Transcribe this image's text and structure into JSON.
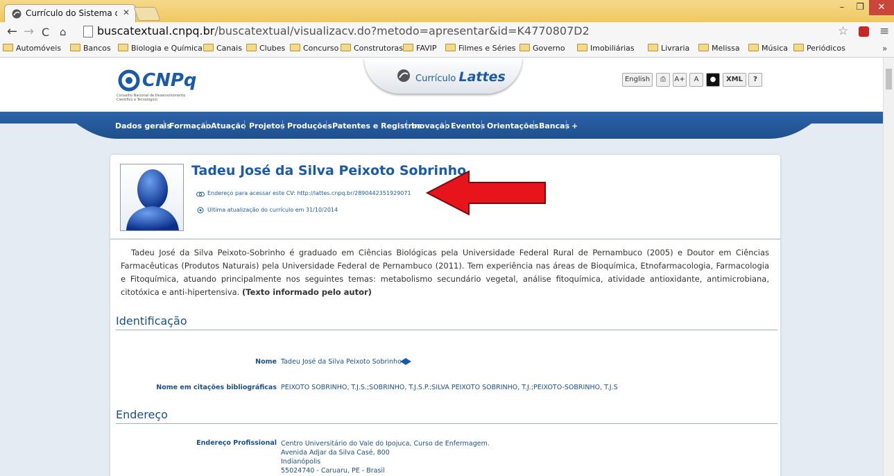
{
  "browser": {
    "tab_title": "Currículo do Sistema de C",
    "url_host": "buscatextual.cnpq.br",
    "url_path": "/buscatextual/visualizacv.do?metodo=apresentar&id=K4770807D2"
  },
  "bookmarks": [
    "Automóveis",
    "Bancos",
    "Biologia e Química",
    "Canais",
    "Clubes",
    "Concurso",
    "Construtoras",
    "FAVIP",
    "Filmes e Séries",
    "Governo",
    "Imobiliárias",
    "Livraria",
    "Melissa",
    "Música",
    "Periódicos"
  ],
  "header": {
    "cnpq_logo_text": "CNPq",
    "cnpq_subtitle": "Conselho Nacional de Desenvolvimento Científico e Tecnológico",
    "lattes_prefix": "Currículo",
    "lattes_name": "Lattes",
    "tool_english": "English",
    "tool_font_plus": "A+",
    "tool_font_normal": "A",
    "tool_xml": "XML",
    "tool_help": "?"
  },
  "nav": [
    "Dados gerais",
    "Formação",
    "Atuação",
    "Projetos",
    "Produções",
    "Patentes e Registros",
    "Inovação",
    "Eventos",
    "Orientações",
    "Bancas",
    "+"
  ],
  "profile": {
    "name": "Tadeu José da Silva Peixoto Sobrinho",
    "cv_address": "Endereço para acessar este CV: http://lattes.cnpq.br/2890442351929071",
    "last_update": "Última atualização do currículo em 31/10/2014",
    "summary": "Tadeu José da Silva Peixoto-Sobrinho é graduado em Ciências Biológicas pela Universidade Federal Rural de Pernambuco (2005) e Doutor em Ciências Farmacêuticas (Produtos Naturais) pela Universidade Federal de Pernambuco (2011). Tem experiência nas áreas de Bioquímica, Etnofarmacologia, Farmacologia e Fitoquímica, atuando principalmente nos seguintes temas: metabolismo secundário vegetal, análise fitoquímica, atividade antioxidante, antimicrobiana, citotóxica e anti-hipertensiva.",
    "summary_note": "(Texto informado pelo autor)"
  },
  "identificacao": {
    "title": "Identificação",
    "nome_label": "Nome",
    "nome_value": "Tadeu José da Silva Peixoto Sobrinho",
    "citacoes_label": "Nome em citações bibliográficas",
    "citacoes_value": "PEIXOTO SOBRINHO, T.J.S.;SOBRINHO, T.J.S.P.;SILVA PEIXOTO SOBRINHO, T.J.;PEIXOTO-SOBRINHO, T.J.S"
  },
  "endereco": {
    "title": "Endereço",
    "label": "Endereço Profissional",
    "lines": [
      "Centro Universitário do Vale do Ipojuca, Curso de Enfermagem.",
      "Avenida Adjar da Silva Casé, 800",
      "Indianópolis",
      "55024740 - Caruaru, PE - Brasil"
    ]
  },
  "colors": {
    "brand_blue": "#1a5aa6",
    "nav_blue": "#2c63a8",
    "arrow_red": "#e8141c"
  }
}
